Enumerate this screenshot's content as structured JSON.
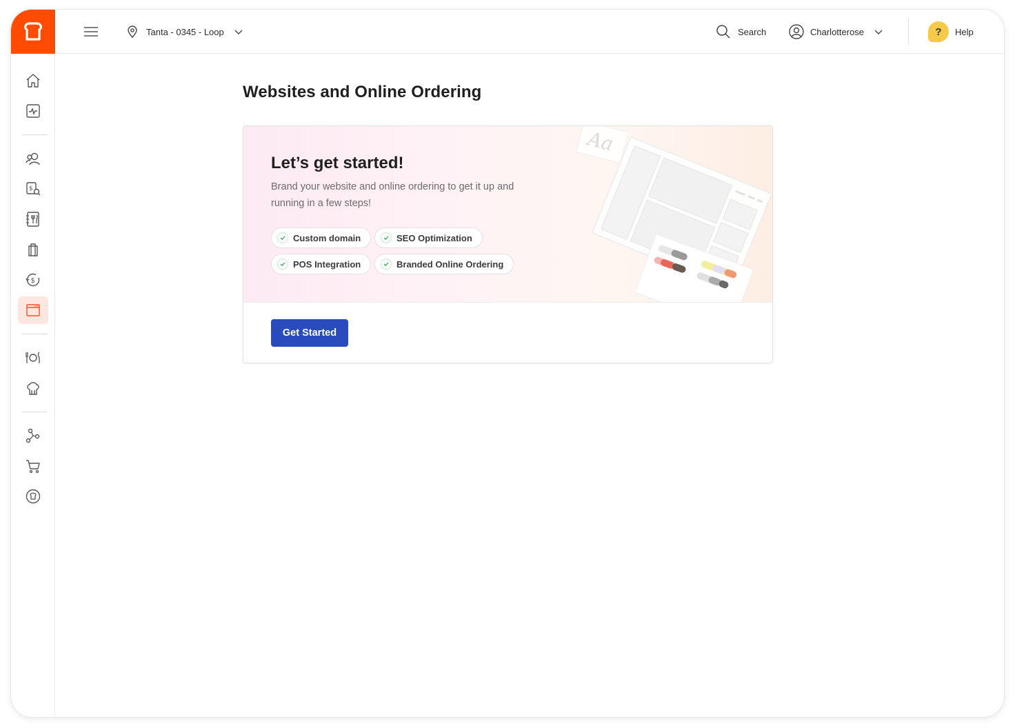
{
  "header": {
    "location": "Tanta - 0345 -  Loop",
    "search_label": "Search",
    "user_name": "Charlotterose",
    "help_label": "Help",
    "help_badge": "?"
  },
  "page": {
    "title": "Websites and Online Ordering"
  },
  "card": {
    "title": "Let’s get started!",
    "description": "Brand your website and online ordering to get it up and running in a few steps!",
    "features": [
      "Custom domain",
      "SEO Optimization",
      "POS Integration",
      "Branded Online Ordering"
    ],
    "cta_label": "Get Started",
    "illustration_text": "Aa"
  },
  "sidebar": {
    "active_item": "websites",
    "items": [
      "home",
      "analytics",
      "guests",
      "payments",
      "menu",
      "orders",
      "loyalty",
      "websites",
      "restaurant",
      "kitchen",
      "integrations",
      "shop",
      "account"
    ]
  },
  "colors": {
    "brand": "#ff4c00",
    "primary_button": "#2a4bbd",
    "active_nav_bg": "#fde7e0",
    "help_badge": "#f7c948",
    "check": "#3aa757"
  }
}
